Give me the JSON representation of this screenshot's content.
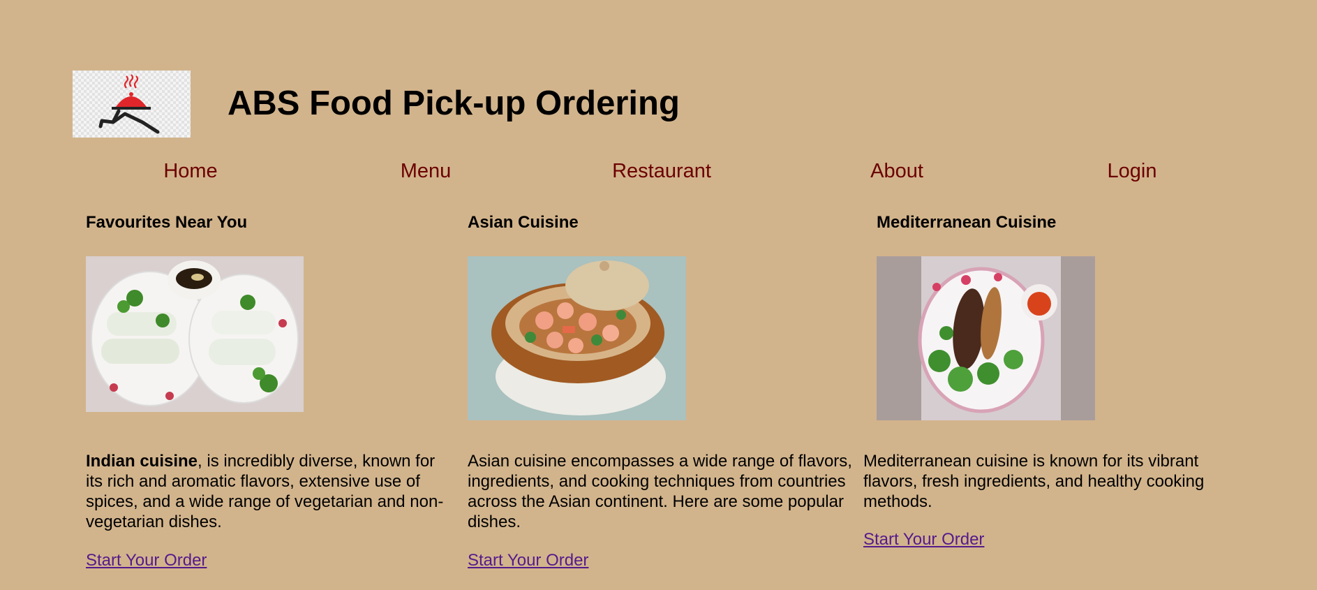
{
  "header": {
    "title": "ABS Food Pick-up Ordering",
    "logo_icon": "running-food-cloche-logo"
  },
  "nav": {
    "items": [
      {
        "label": "Home"
      },
      {
        "label": "Menu"
      },
      {
        "label": "Restaurant"
      },
      {
        "label": "About"
      },
      {
        "label": "Login"
      }
    ]
  },
  "sections": [
    {
      "heading": "Favourites Near You",
      "image_icon": "spring-rolls-photo",
      "desc_bold": "Indian cuisine",
      "desc_rest": ", is incredibly diverse, known for its rich and aromatic flavors, extensive use of spices, and a wide range of vegetarian and non-vegetarian dishes.",
      "link": "Start Your Order"
    },
    {
      "heading": "Asian Cuisine",
      "image_icon": "shrimp-clay-pot-photo",
      "desc": "Asian cuisine encompasses a wide range of flavors, ingredients, and cooking techniques from countries across the Asian continent. Here are some popular dishes.",
      "link": "Start Your Order"
    },
    {
      "heading": "Mediterranean Cuisine",
      "image_icon": "grilled-meat-salad-photo",
      "desc": "Mediterranean cuisine is known for its vibrant flavors, fresh ingredients, and healthy cooking methods.",
      "link": "Start Your Order"
    }
  ],
  "colors": {
    "background": "#d2b48c",
    "nav_link": "#6b0000",
    "visited_link": "#551a8b"
  }
}
